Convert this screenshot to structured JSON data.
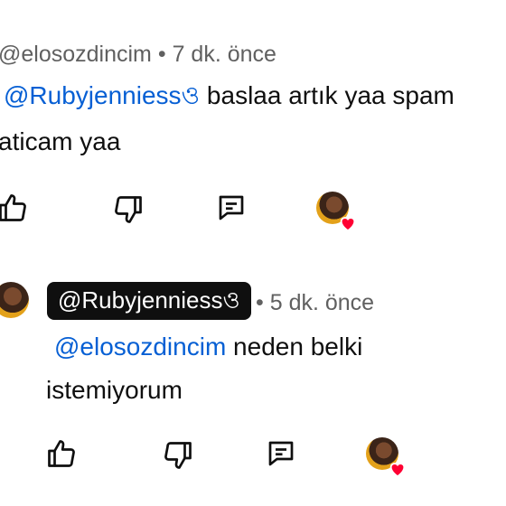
{
  "comment": {
    "author": "@elosozdincim",
    "time_separator": "•",
    "time": "7 dk. önce",
    "mention": "@Rubyjenniessও",
    "text_line1": " baslaa artık yaa spam",
    "text_line2": "aticam yaa"
  },
  "reply": {
    "author": "@Rubyjenniessও",
    "time_separator": "•",
    "time": "5 dk. önce",
    "mention": "@elosozdincim",
    "text_line1": " neden belki",
    "text_line2": "istemiyorum"
  },
  "actions": {
    "like_icon": "thumbs-up-icon",
    "dislike_icon": "thumbs-down-icon",
    "reply_icon": "reply-comment-icon",
    "creator_heart": "creator-heart-avatar"
  },
  "colors": {
    "mention": "#065fd4",
    "meta": "#606060",
    "heart": "#ff0033",
    "chip_bg": "#0f0f0f"
  }
}
